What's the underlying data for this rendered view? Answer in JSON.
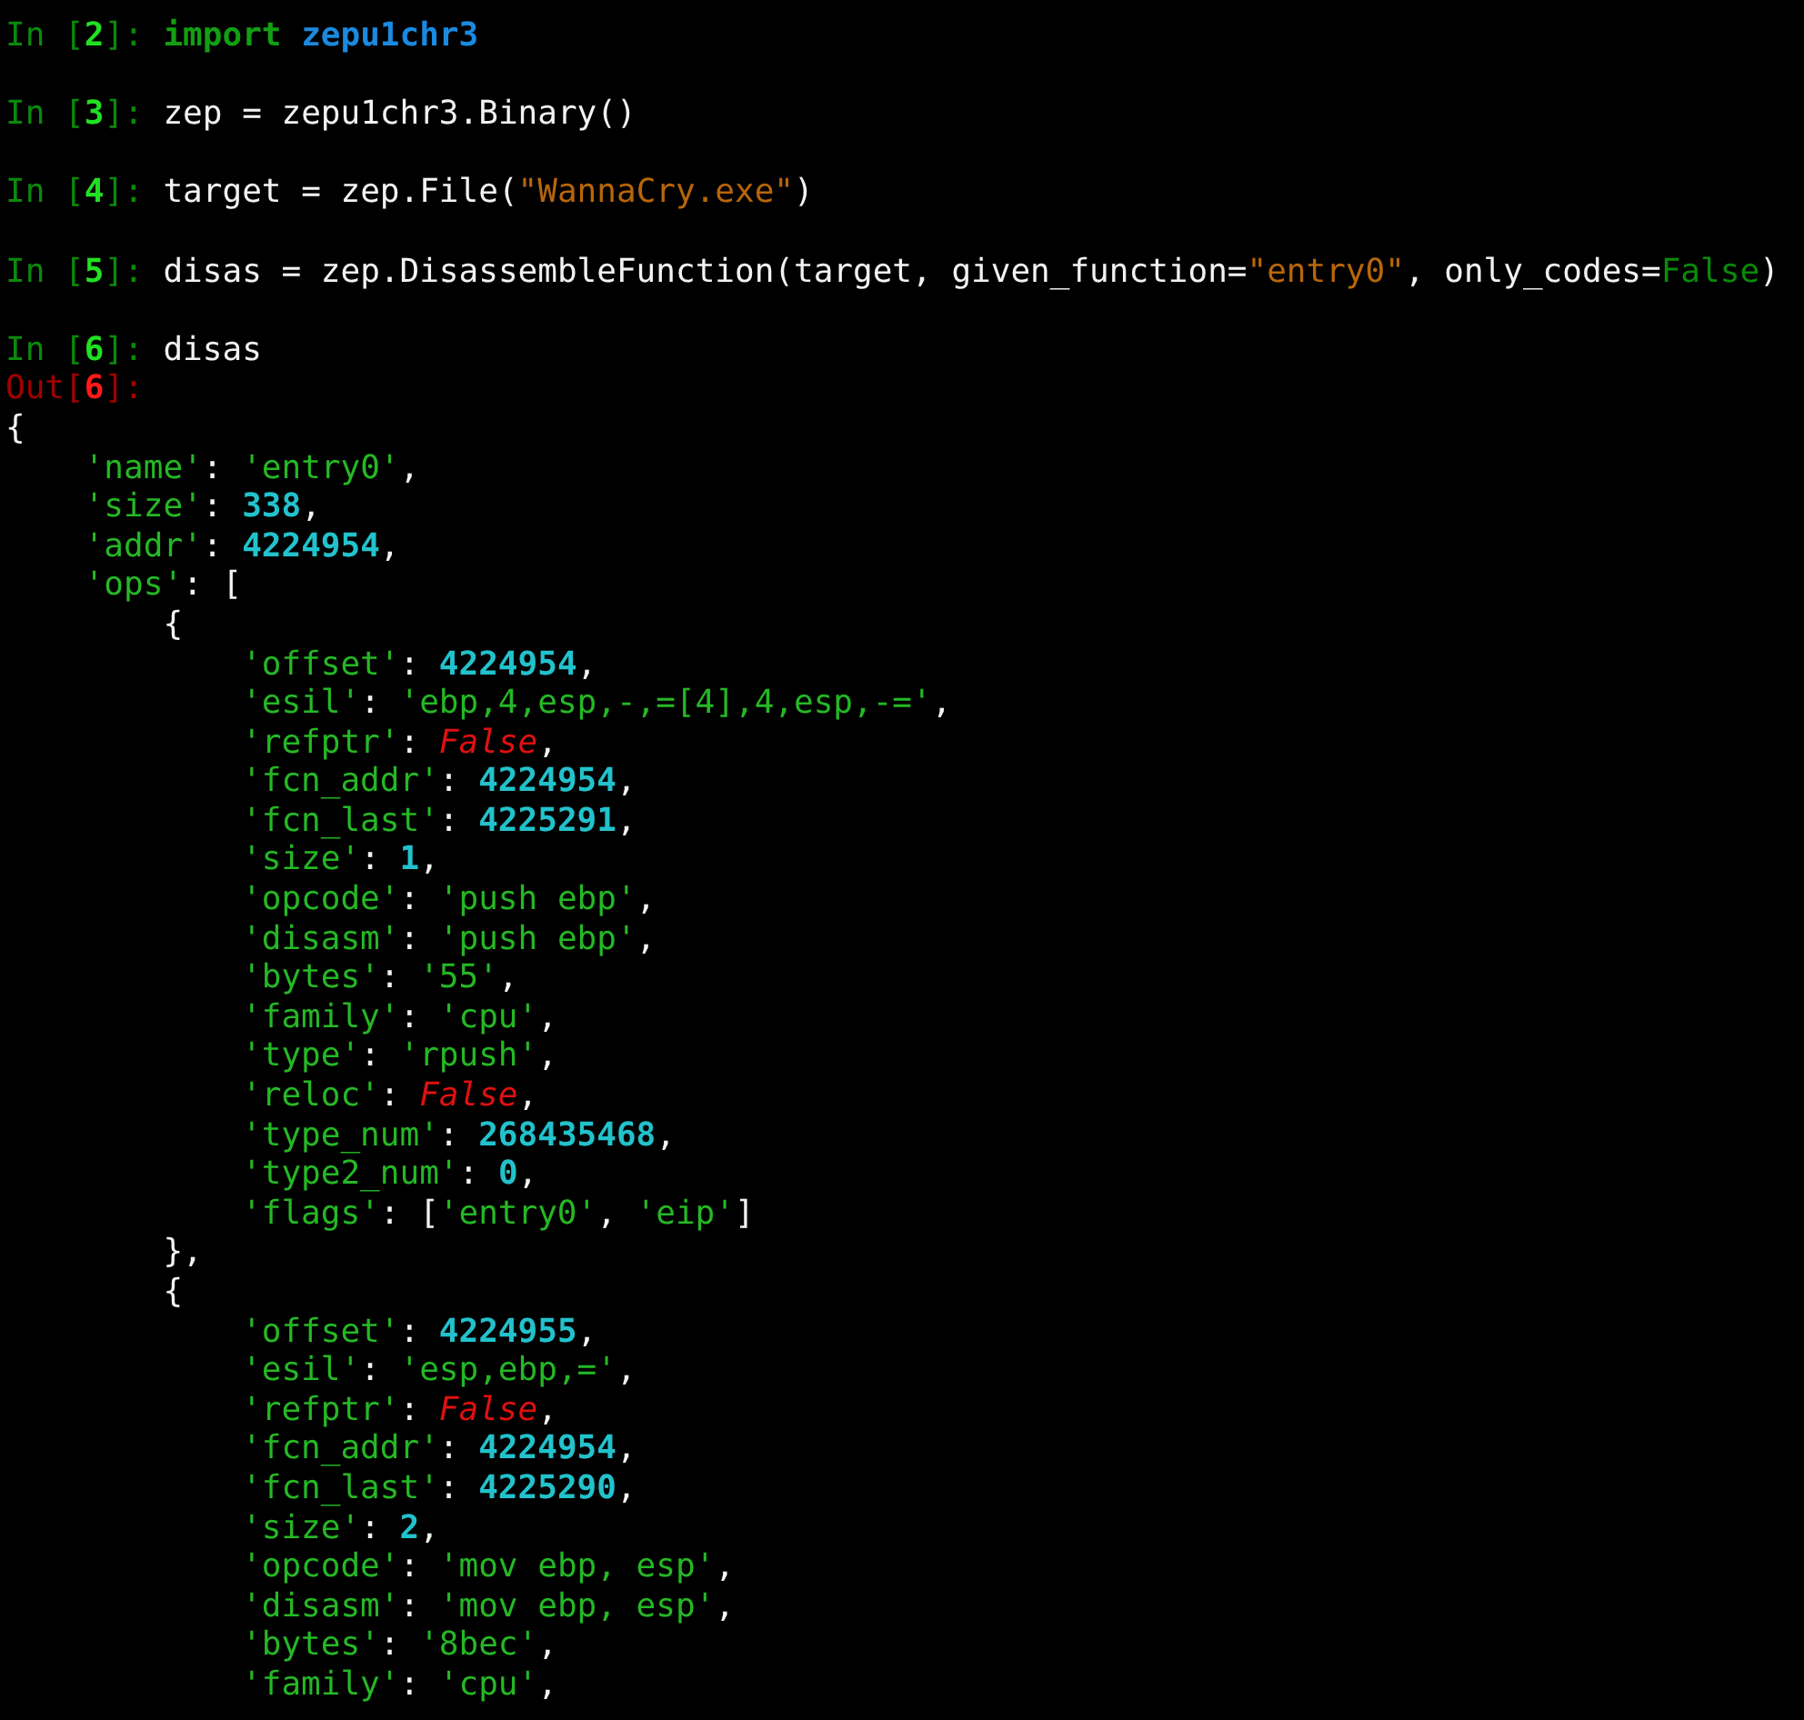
{
  "inputs": [
    {
      "prompt": {
        "prefix": "In [",
        "number": "2",
        "suffix": "]: "
      },
      "code": [
        {
          "kind": "keyword",
          "text": "import "
        },
        {
          "kind": "module",
          "text": "zepu1chr3"
        }
      ]
    },
    {
      "prompt": {
        "prefix": "In [",
        "number": "3",
        "suffix": "]: "
      },
      "code": [
        {
          "kind": "plain",
          "text": "zep = zepu1chr3.Binary()"
        }
      ]
    },
    {
      "prompt": {
        "prefix": "In [",
        "number": "4",
        "suffix": "]: "
      },
      "code": [
        {
          "kind": "plain",
          "text": "target = zep.File("
        },
        {
          "kind": "string",
          "text": "\"WannaCry.exe\""
        },
        {
          "kind": "plain",
          "text": ")"
        }
      ]
    },
    {
      "prompt": {
        "prefix": "In [",
        "number": "5",
        "suffix": "]: "
      },
      "code": [
        {
          "kind": "plain",
          "text": "disas = zep.DisassembleFunction(target, given_function="
        },
        {
          "kind": "string",
          "text": "\"entry0\""
        },
        {
          "kind": "plain",
          "text": ", only_codes="
        },
        {
          "kind": "constant",
          "text": "False"
        },
        {
          "kind": "plain",
          "text": ")"
        }
      ]
    },
    {
      "prompt": {
        "prefix": "In [",
        "number": "6",
        "suffix": "]: "
      },
      "code": [
        {
          "kind": "plain",
          "text": "disas"
        }
      ]
    }
  ],
  "output": {
    "prompt": {
      "prefix": "Out[",
      "number": "6",
      "suffix": "]:"
    },
    "lines": [
      {
        "tokens": [
          {
            "kind": "punct",
            "text": "{"
          }
        ],
        "children": [
          {
            "tokens": [
              {
                "kind": "str",
                "text": "'name'"
              },
              {
                "kind": "punct",
                "text": ": "
              },
              {
                "kind": "str",
                "text": "'entry0'"
              },
              {
                "kind": "punct",
                "text": ","
              }
            ]
          },
          {
            "tokens": [
              {
                "kind": "str",
                "text": "'size'"
              },
              {
                "kind": "punct",
                "text": ": "
              },
              {
                "kind": "num",
                "text": "338"
              },
              {
                "kind": "punct",
                "text": ","
              }
            ]
          },
          {
            "tokens": [
              {
                "kind": "str",
                "text": "'addr'"
              },
              {
                "kind": "punct",
                "text": ": "
              },
              {
                "kind": "num",
                "text": "4224954"
              },
              {
                "kind": "punct",
                "text": ","
              }
            ]
          },
          {
            "tokens": [
              {
                "kind": "str",
                "text": "'ops'"
              },
              {
                "kind": "punct",
                "text": ": ["
              }
            ],
            "children": [
              {
                "tokens": [
                  {
                    "kind": "punct",
                    "text": "{"
                  }
                ],
                "children": [
                  {
                    "tokens": [
                      {
                        "kind": "str",
                        "text": "'offset'"
                      },
                      {
                        "kind": "punct",
                        "text": ": "
                      },
                      {
                        "kind": "num",
                        "text": "4224954"
                      },
                      {
                        "kind": "punct",
                        "text": ","
                      }
                    ]
                  },
                  {
                    "tokens": [
                      {
                        "kind": "str",
                        "text": "'esil'"
                      },
                      {
                        "kind": "punct",
                        "text": ": "
                      },
                      {
                        "kind": "str",
                        "text": "'ebp,4,esp,-,=[4],4,esp,-='"
                      },
                      {
                        "kind": "punct",
                        "text": ","
                      }
                    ]
                  },
                  {
                    "tokens": [
                      {
                        "kind": "str",
                        "text": "'refptr'"
                      },
                      {
                        "kind": "punct",
                        "text": ": "
                      },
                      {
                        "kind": "false",
                        "text": "False"
                      },
                      {
                        "kind": "punct",
                        "text": ","
                      }
                    ]
                  },
                  {
                    "tokens": [
                      {
                        "kind": "str",
                        "text": "'fcn_addr'"
                      },
                      {
                        "kind": "punct",
                        "text": ": "
                      },
                      {
                        "kind": "num",
                        "text": "4224954"
                      },
                      {
                        "kind": "punct",
                        "text": ","
                      }
                    ]
                  },
                  {
                    "tokens": [
                      {
                        "kind": "str",
                        "text": "'fcn_last'"
                      },
                      {
                        "kind": "punct",
                        "text": ": "
                      },
                      {
                        "kind": "num",
                        "text": "4225291"
                      },
                      {
                        "kind": "punct",
                        "text": ","
                      }
                    ]
                  },
                  {
                    "tokens": [
                      {
                        "kind": "str",
                        "text": "'size'"
                      },
                      {
                        "kind": "punct",
                        "text": ": "
                      },
                      {
                        "kind": "num",
                        "text": "1"
                      },
                      {
                        "kind": "punct",
                        "text": ","
                      }
                    ]
                  },
                  {
                    "tokens": [
                      {
                        "kind": "str",
                        "text": "'opcode'"
                      },
                      {
                        "kind": "punct",
                        "text": ": "
                      },
                      {
                        "kind": "str",
                        "text": "'push ebp'"
                      },
                      {
                        "kind": "punct",
                        "text": ","
                      }
                    ]
                  },
                  {
                    "tokens": [
                      {
                        "kind": "str",
                        "text": "'disasm'"
                      },
                      {
                        "kind": "punct",
                        "text": ": "
                      },
                      {
                        "kind": "str",
                        "text": "'push ebp'"
                      },
                      {
                        "kind": "punct",
                        "text": ","
                      }
                    ]
                  },
                  {
                    "tokens": [
                      {
                        "kind": "str",
                        "text": "'bytes'"
                      },
                      {
                        "kind": "punct",
                        "text": ": "
                      },
                      {
                        "kind": "str",
                        "text": "'55'"
                      },
                      {
                        "kind": "punct",
                        "text": ","
                      }
                    ]
                  },
                  {
                    "tokens": [
                      {
                        "kind": "str",
                        "text": "'family'"
                      },
                      {
                        "kind": "punct",
                        "text": ": "
                      },
                      {
                        "kind": "str",
                        "text": "'cpu'"
                      },
                      {
                        "kind": "punct",
                        "text": ","
                      }
                    ]
                  },
                  {
                    "tokens": [
                      {
                        "kind": "str",
                        "text": "'type'"
                      },
                      {
                        "kind": "punct",
                        "text": ": "
                      },
                      {
                        "kind": "str",
                        "text": "'rpush'"
                      },
                      {
                        "kind": "punct",
                        "text": ","
                      }
                    ]
                  },
                  {
                    "tokens": [
                      {
                        "kind": "str",
                        "text": "'reloc'"
                      },
                      {
                        "kind": "punct",
                        "text": ": "
                      },
                      {
                        "kind": "false",
                        "text": "False"
                      },
                      {
                        "kind": "punct",
                        "text": ","
                      }
                    ]
                  },
                  {
                    "tokens": [
                      {
                        "kind": "str",
                        "text": "'type_num'"
                      },
                      {
                        "kind": "punct",
                        "text": ": "
                      },
                      {
                        "kind": "num",
                        "text": "268435468"
                      },
                      {
                        "kind": "punct",
                        "text": ","
                      }
                    ]
                  },
                  {
                    "tokens": [
                      {
                        "kind": "str",
                        "text": "'type2_num'"
                      },
                      {
                        "kind": "punct",
                        "text": ": "
                      },
                      {
                        "kind": "num",
                        "text": "0"
                      },
                      {
                        "kind": "punct",
                        "text": ","
                      }
                    ]
                  },
                  {
                    "tokens": [
                      {
                        "kind": "str",
                        "text": "'flags'"
                      },
                      {
                        "kind": "punct",
                        "text": ": ["
                      },
                      {
                        "kind": "str",
                        "text": "'entry0'"
                      },
                      {
                        "kind": "punct",
                        "text": ", "
                      },
                      {
                        "kind": "str",
                        "text": "'eip'"
                      },
                      {
                        "kind": "punct",
                        "text": "]"
                      }
                    ]
                  }
                ]
              },
              {
                "tokens": [
                  {
                    "kind": "punct",
                    "text": "},"
                  }
                ]
              },
              {
                "tokens": [
                  {
                    "kind": "punct",
                    "text": "{"
                  }
                ],
                "children": [
                  {
                    "tokens": [
                      {
                        "kind": "str",
                        "text": "'offset'"
                      },
                      {
                        "kind": "punct",
                        "text": ": "
                      },
                      {
                        "kind": "num",
                        "text": "4224955"
                      },
                      {
                        "kind": "punct",
                        "text": ","
                      }
                    ]
                  },
                  {
                    "tokens": [
                      {
                        "kind": "str",
                        "text": "'esil'"
                      },
                      {
                        "kind": "punct",
                        "text": ": "
                      },
                      {
                        "kind": "str",
                        "text": "'esp,ebp,='"
                      },
                      {
                        "kind": "punct",
                        "text": ","
                      }
                    ]
                  },
                  {
                    "tokens": [
                      {
                        "kind": "str",
                        "text": "'refptr'"
                      },
                      {
                        "kind": "punct",
                        "text": ": "
                      },
                      {
                        "kind": "false",
                        "text": "False"
                      },
                      {
                        "kind": "punct",
                        "text": ","
                      }
                    ]
                  },
                  {
                    "tokens": [
                      {
                        "kind": "str",
                        "text": "'fcn_addr'"
                      },
                      {
                        "kind": "punct",
                        "text": ": "
                      },
                      {
                        "kind": "num",
                        "text": "4224954"
                      },
                      {
                        "kind": "punct",
                        "text": ","
                      }
                    ]
                  },
                  {
                    "tokens": [
                      {
                        "kind": "str",
                        "text": "'fcn_last'"
                      },
                      {
                        "kind": "punct",
                        "text": ": "
                      },
                      {
                        "kind": "num",
                        "text": "4225290"
                      },
                      {
                        "kind": "punct",
                        "text": ","
                      }
                    ]
                  },
                  {
                    "tokens": [
                      {
                        "kind": "str",
                        "text": "'size'"
                      },
                      {
                        "kind": "punct",
                        "text": ": "
                      },
                      {
                        "kind": "num",
                        "text": "2"
                      },
                      {
                        "kind": "punct",
                        "text": ","
                      }
                    ]
                  },
                  {
                    "tokens": [
                      {
                        "kind": "str",
                        "text": "'opcode'"
                      },
                      {
                        "kind": "punct",
                        "text": ": "
                      },
                      {
                        "kind": "str",
                        "text": "'mov ebp, esp'"
                      },
                      {
                        "kind": "punct",
                        "text": ","
                      }
                    ]
                  },
                  {
                    "tokens": [
                      {
                        "kind": "str",
                        "text": "'disasm'"
                      },
                      {
                        "kind": "punct",
                        "text": ": "
                      },
                      {
                        "kind": "str",
                        "text": "'mov ebp, esp'"
                      },
                      {
                        "kind": "punct",
                        "text": ","
                      }
                    ]
                  },
                  {
                    "tokens": [
                      {
                        "kind": "str",
                        "text": "'bytes'"
                      },
                      {
                        "kind": "punct",
                        "text": ": "
                      },
                      {
                        "kind": "str",
                        "text": "'8bec'"
                      },
                      {
                        "kind": "punct",
                        "text": ","
                      }
                    ]
                  },
                  {
                    "tokens": [
                      {
                        "kind": "str",
                        "text": "'family'"
                      },
                      {
                        "kind": "punct",
                        "text": ": "
                      },
                      {
                        "kind": "str",
                        "text": "'cpu'"
                      },
                      {
                        "kind": "punct",
                        "text": ","
                      }
                    ]
                  }
                ]
              }
            ]
          }
        ]
      }
    ]
  }
}
